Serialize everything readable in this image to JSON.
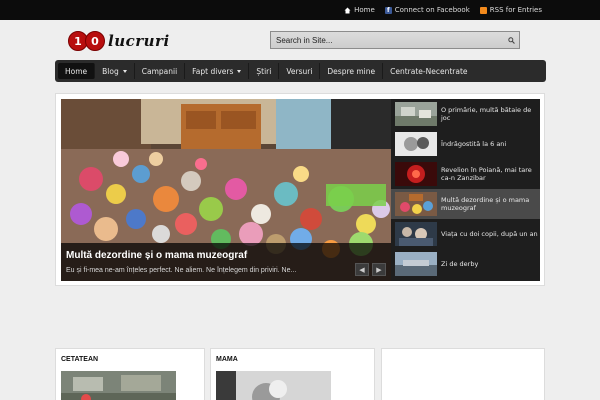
{
  "topbar": {
    "links": [
      {
        "label": "Home",
        "icon": "home-icon",
        "color": "#ffffff"
      },
      {
        "label": "Connect on Facebook",
        "icon": "facebook-icon",
        "color": "#3b5998"
      },
      {
        "label": "RSS for Entries",
        "icon": "rss-icon",
        "color": "#f28a1c"
      }
    ]
  },
  "logo": {
    "badge": "10",
    "digit_one": "1",
    "digit_zero": "0",
    "word": "lucruri",
    "badge_color": "#b80e0e"
  },
  "search": {
    "placeholder": "Search in Site..."
  },
  "nav": {
    "items": [
      {
        "label": "Home"
      },
      {
        "label": "Blog"
      },
      {
        "label": "Campanii"
      },
      {
        "label": "Fapt divers"
      },
      {
        "label": "Știri"
      },
      {
        "label": "Versuri"
      },
      {
        "label": "Despre mine"
      },
      {
        "label": "Centrate-Necentrate"
      }
    ]
  },
  "featured": {
    "title": "Multă dezordine și o mama muzeograf",
    "excerpt": "Eu și fi-mea ne-am înțeles perfect. Ne aliem. Ne înțelegem din priviri. Ne...",
    "prev_label": "◀",
    "next_label": "▶",
    "thumbs": [
      {
        "label": "O primărie, multă bătaie de joc"
      },
      {
        "label": "Îndrăgostită la 6 ani"
      },
      {
        "label": "Revelion în Poiană, mai tare ca-n Zanzibar"
      },
      {
        "label": "Multă dezordine și o mama muzeograf"
      },
      {
        "label": "Viața cu doi copii, după un an"
      },
      {
        "label": "Zi de derby"
      }
    ]
  },
  "boxes": [
    {
      "title": "CETATEAN"
    },
    {
      "title": "MAMA"
    },
    {
      "title": ""
    }
  ]
}
